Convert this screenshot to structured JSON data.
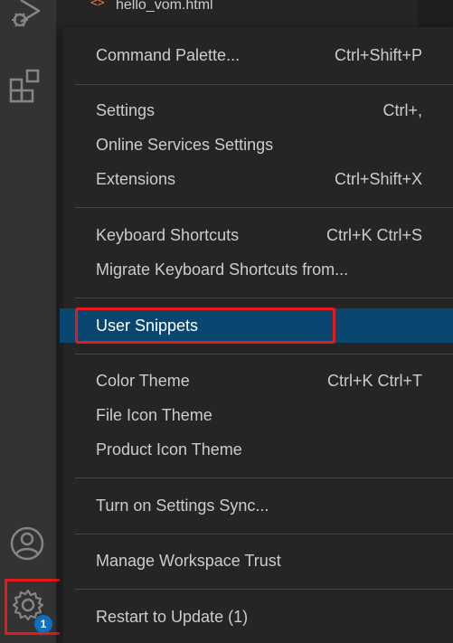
{
  "explorer": {
    "file_icon": "<>",
    "file_name": "hello_vom.html"
  },
  "activity_bar": {
    "icons": [
      "run-debug-icon",
      "extensions-icon",
      "account-icon",
      "gear-icon"
    ],
    "badge": "1"
  },
  "menu": {
    "command_palette": {
      "label": "Command Palette...",
      "shortcut": "Ctrl+Shift+P"
    },
    "settings": {
      "label": "Settings",
      "shortcut": "Ctrl+,"
    },
    "online_services": {
      "label": "Online Services Settings",
      "shortcut": ""
    },
    "extensions": {
      "label": "Extensions",
      "shortcut": "Ctrl+Shift+X"
    },
    "keyboard_shortcuts": {
      "label": "Keyboard Shortcuts",
      "shortcut": "Ctrl+K Ctrl+S"
    },
    "migrate_shortcuts": {
      "label": "Migrate Keyboard Shortcuts from...",
      "shortcut": ""
    },
    "user_snippets": {
      "label": "User Snippets",
      "shortcut": ""
    },
    "color_theme": {
      "label": "Color Theme",
      "shortcut": "Ctrl+K Ctrl+T"
    },
    "file_icon_theme": {
      "label": "File Icon Theme",
      "shortcut": ""
    },
    "product_icon_theme": {
      "label": "Product Icon Theme",
      "shortcut": ""
    },
    "settings_sync": {
      "label": "Turn on Settings Sync...",
      "shortcut": ""
    },
    "workspace_trust": {
      "label": "Manage Workspace Trust",
      "shortcut": ""
    },
    "restart": {
      "label": "Restart to Update (1)",
      "shortcut": ""
    }
  },
  "colors": {
    "selected_bg": "#094771",
    "highlight": "#e51b1b",
    "badge": "#0e70c0"
  }
}
